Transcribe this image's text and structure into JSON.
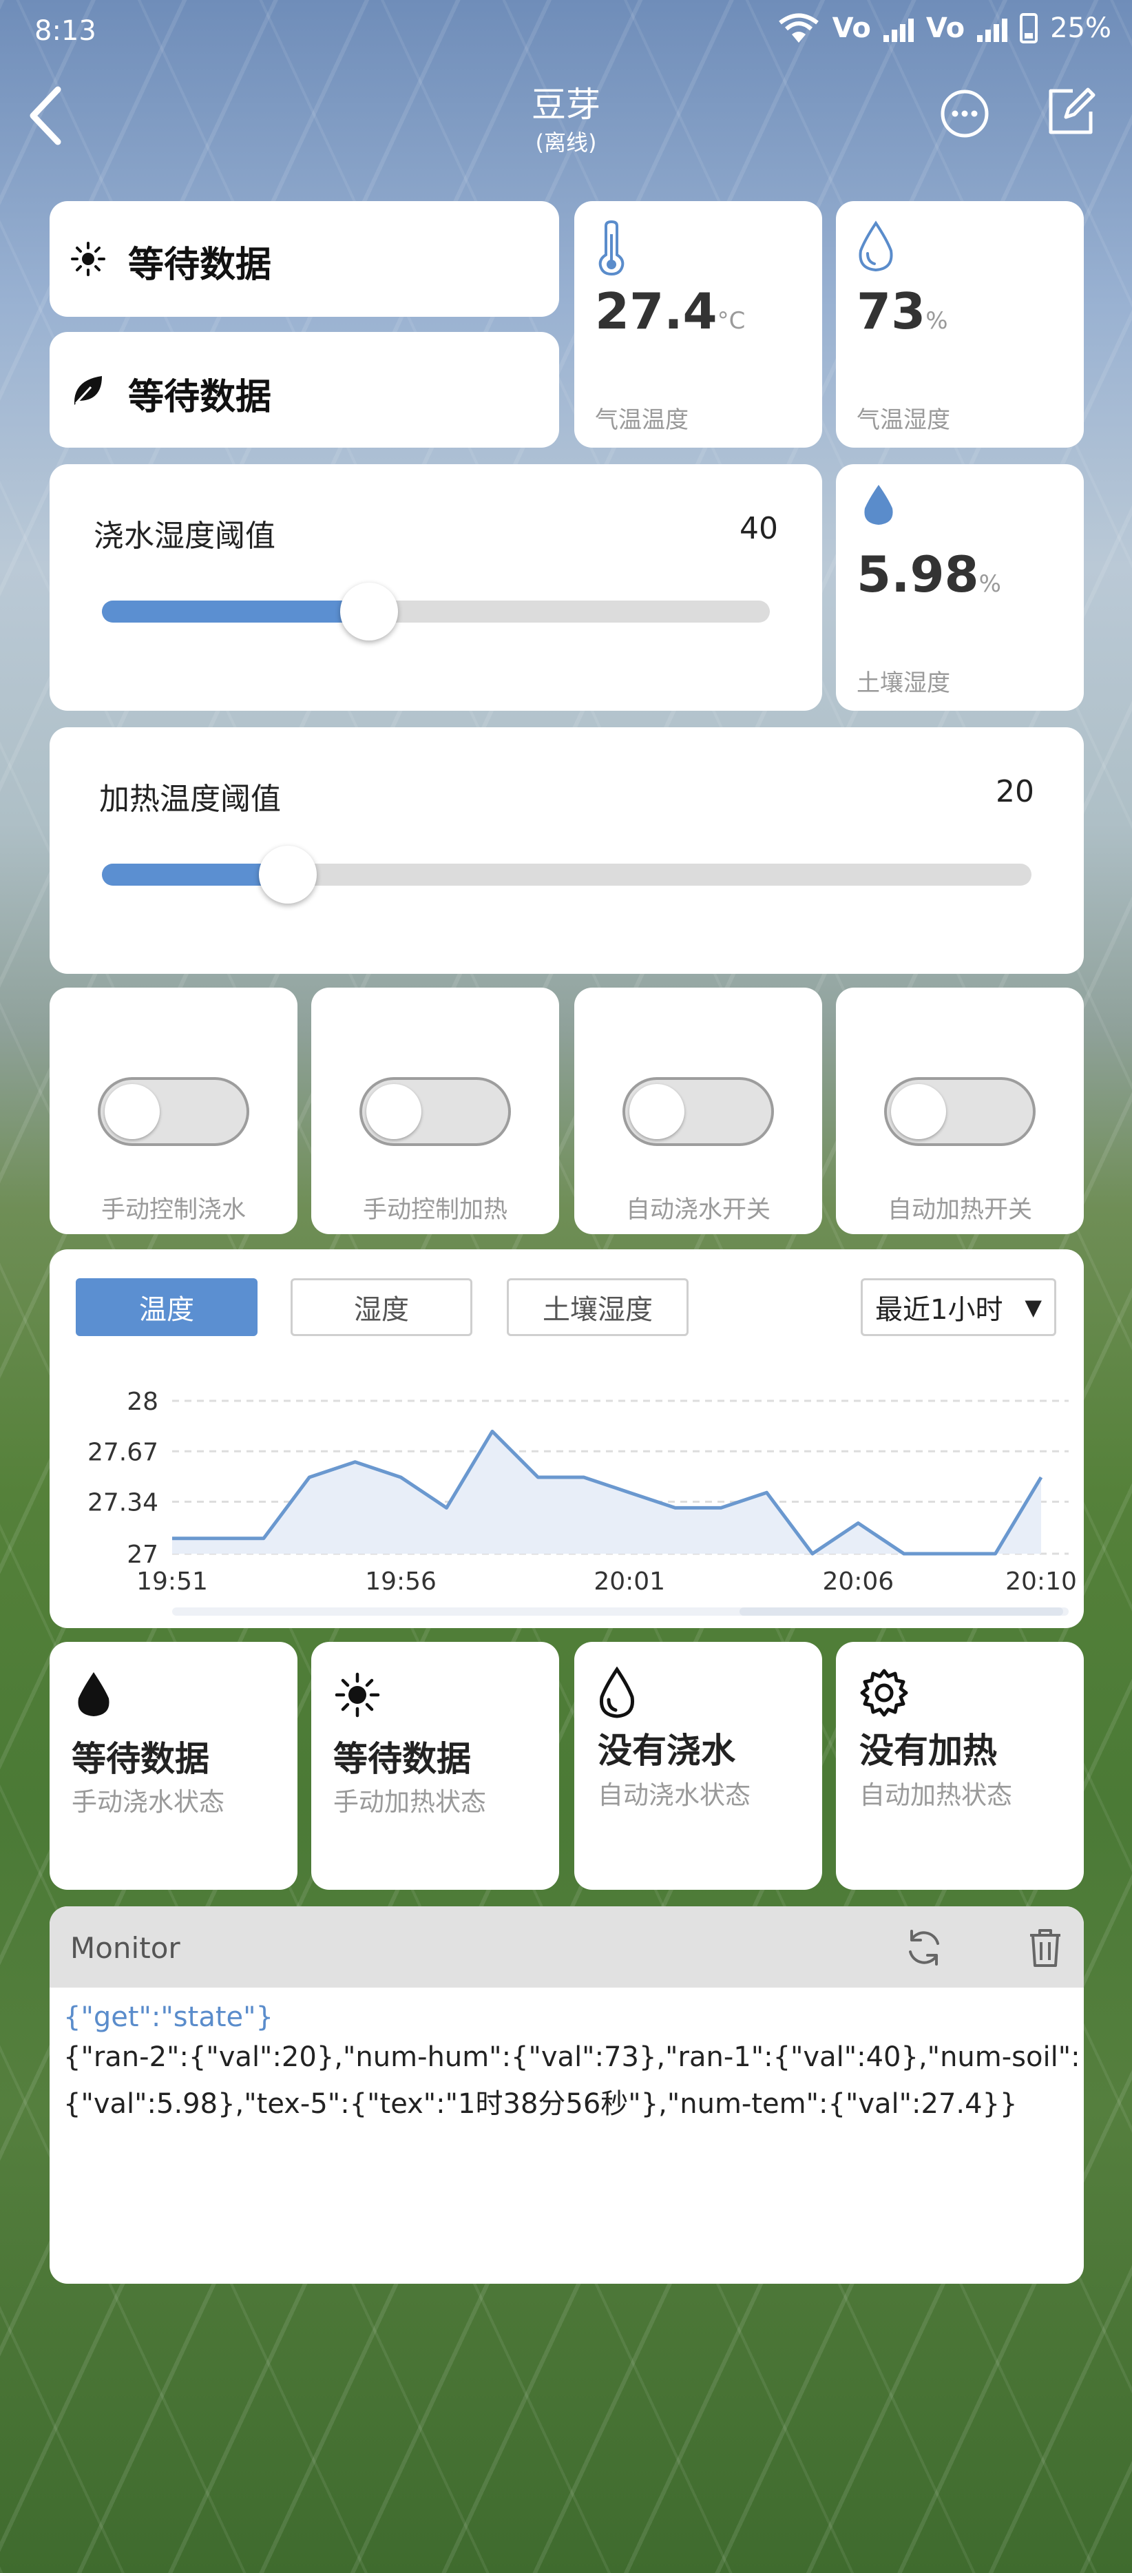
{
  "status_bar": {
    "time": "8:13",
    "battery": "25%",
    "network_1": "Vo",
    "network_2": "Vo"
  },
  "header": {
    "title": "豆芽",
    "subtitle": "(离线)"
  },
  "text_tiles": [
    {
      "icon": "sun-icon",
      "text": "等待数据"
    },
    {
      "icon": "leaf-icon",
      "text": "等待数据"
    }
  ],
  "sensors": {
    "air_temp": {
      "value": "27.4",
      "unit": "°C",
      "label": "气温温度"
    },
    "air_hum": {
      "value": "73",
      "unit": "%",
      "label": "气温湿度"
    },
    "soil_hum": {
      "value": "5.98",
      "unit": "%",
      "label": "土壤湿度"
    }
  },
  "sliders": {
    "water": {
      "label": "浇水湿度阈值",
      "value": 40,
      "max": 100
    },
    "heat": {
      "label": "加热温度阈值",
      "value": 20,
      "max": 100
    }
  },
  "switches": [
    {
      "label": "手动控制浇水",
      "on": false
    },
    {
      "label": "手动控制加热",
      "on": false
    },
    {
      "label": "自动浇水开关",
      "on": false
    },
    {
      "label": "自动加热开关",
      "on": false
    }
  ],
  "chart_tabs": [
    {
      "label": "温度",
      "active": true
    },
    {
      "label": "湿度",
      "active": false
    },
    {
      "label": "土壤湿度",
      "active": false
    }
  ],
  "range_select": "最近1小时",
  "chart_data": {
    "type": "area",
    "title": "",
    "xlabel": "",
    "ylabel": "",
    "ylim": [
      27,
      28
    ],
    "yticks": [
      "28",
      "27.67",
      "27.34",
      "27"
    ],
    "xticks": [
      "19:51",
      "19:56",
      "20:01",
      "20:06",
      "20:10"
    ],
    "x": [
      "19:51",
      "19:52",
      "19:53",
      "19:54",
      "19:55",
      "19:56",
      "19:57",
      "19:58",
      "19:59",
      "20:00",
      "20:01",
      "20:02",
      "20:03",
      "20:04",
      "20:05",
      "20:06",
      "20:07",
      "20:08",
      "20:09",
      "20:10"
    ],
    "values": [
      27.1,
      27.1,
      27.1,
      27.5,
      27.6,
      27.5,
      27.3,
      27.8,
      27.5,
      27.5,
      27.4,
      27.3,
      27.3,
      27.4,
      27.0,
      27.2,
      27.0,
      27.0,
      27.0,
      27.5
    ],
    "grid": true,
    "series_color": "#6a98cf"
  },
  "status_tiles": [
    {
      "icon": "drop-icon",
      "title": "等待数据",
      "sub": "手动浇水状态"
    },
    {
      "icon": "sun-icon",
      "title": "等待数据",
      "sub": "手动加热状态"
    },
    {
      "icon": "drop-outline-icon",
      "title": "没有浇水",
      "sub": "自动浇水状态"
    },
    {
      "icon": "gear-icon",
      "title": "没有加热",
      "sub": "自动加热状态"
    }
  ],
  "monitor": {
    "title": "Monitor",
    "line1": "{\"get\":\"state\"}",
    "line2": "{\"ran-2\":{\"val\":20},\"num-hum\":{\"val\":73},\"ran-1\":{\"val\":40},\"num-soil\":",
    "line3": "{\"val\":5.98},\"tex-5\":{\"tex\":\"1时38分56秒\"},\"num-tem\":{\"val\":27.4}}"
  },
  "colors": {
    "accent": "#5b8fd1",
    "icon": "#5a8ccb",
    "card": "#ffffff"
  }
}
